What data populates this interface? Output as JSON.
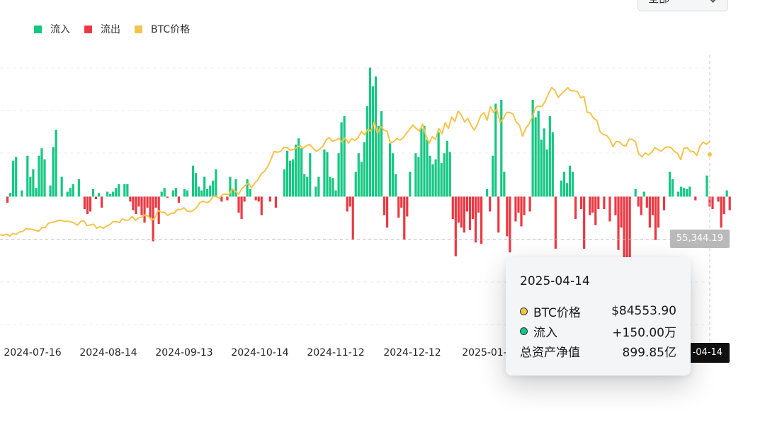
{
  "selector": {
    "value": "全部"
  },
  "legend": [
    {
      "label": "流入",
      "color": "#16c784"
    },
    {
      "label": "流出",
      "color": "#ea3943"
    },
    {
      "label": "BTC价格",
      "color": "#f3c44a"
    }
  ],
  "price_marker": {
    "value": "55,344.19"
  },
  "date_marker": {
    "value": "-04-14"
  },
  "tooltip": {
    "date": "2025-04-14",
    "rows": [
      {
        "label": "BTC价格",
        "value": "$84553.90",
        "dot_color": "#f3c44a"
      },
      {
        "label": "流入",
        "value": "+150.00万",
        "dot_color": "#16c784"
      },
      {
        "label": "总资产净值",
        "value": "899.85亿"
      }
    ]
  },
  "chart_data": {
    "type": "bar",
    "x_tick_labels": [
      "2024-07-16",
      "2024-08-14",
      "2024-09-13",
      "2024-10-14",
      "2024-11-12",
      "2024-12-12",
      "2025-01-"
    ],
    "grid": true,
    "flows": [
      -0.5,
      0.3,
      2.9,
      3.2,
      0.0,
      0.5,
      0.0,
      3.3,
      1.6,
      2.2,
      0.7,
      3.3,
      3.9,
      3.0,
      0.0,
      0.9,
      4.0,
      5.4,
      0.0,
      1.6,
      0.0,
      0.4,
      0.7,
      1.0,
      0.0,
      1.4,
      0.0,
      -1.0,
      -1.4,
      -1.2,
      0.6,
      -0.2,
      0.3,
      -0.9,
      0.0,
      0.4,
      0.2,
      0.4,
      0.7,
      1.0,
      0.0,
      1.0,
      1.0,
      -0.4,
      -1.1,
      -1.4,
      -0.8,
      -1.5,
      -2.1,
      -0.9,
      -1.7,
      -3.6,
      -0.9,
      -2.2,
      0.4,
      0.7,
      -0.1,
      0.0,
      0.5,
      0.7,
      -0.5,
      0.0,
      0.6,
      0.5,
      0.0,
      2.5,
      1.9,
      0.8,
      0.5,
      1.6,
      0.6,
      0.9,
      1.3,
      2.2,
      0.0,
      -0.4,
      0.0,
      -0.3,
      1.6,
      0.6,
      1.4,
      -1.3,
      -1.8,
      -0.4,
      1.4,
      0.6,
      0.0,
      -0.3,
      -0.4,
      -1.5,
      0.0,
      0.0,
      -0.4,
      0.0,
      -0.9,
      0.0,
      0.0,
      2.2,
      3.7,
      2.9,
      3.0,
      4.2,
      4.7,
      3.9,
      1.8,
      1.6,
      3.5,
      0.0,
      0.8,
      1.6,
      0.0,
      3.8,
      3.6,
      1.6,
      1.5,
      0.5,
      3.5,
      6.0,
      6.5,
      -1.2,
      -0.8,
      -3.5,
      2.0,
      3.5,
      2.8,
      4.4,
      7.3,
      10.4,
      8.9,
      9.7,
      5.7,
      6.9,
      -1.5,
      -2.5,
      4.3,
      3.5,
      1.8,
      -1.7,
      -0.9,
      -3.5,
      -1.6,
      2.0,
      0.0,
      3.5,
      3.2,
      5.5,
      5.7,
      4.6,
      3.3,
      2.6,
      3.0,
      5.2,
      2.7,
      3.5,
      4.5,
      3.6,
      -1.8,
      -4.8,
      -2.1,
      -2.5,
      -2.9,
      -1.2,
      -2.7,
      -1.8,
      -3.7,
      -1.3,
      -3.8,
      0.0,
      0.6,
      -1.2,
      3.3,
      7.5,
      -2.9,
      7.8,
      2.0,
      -3.2,
      -4.5,
      0.0,
      -2.0,
      -1.3,
      -2.4,
      -1.5,
      0.0,
      -1.2,
      7.8,
      6.4,
      6.9,
      4.6,
      5.5,
      3.8,
      6.5,
      5.2,
      -4.2,
      0.0,
      1.3,
      2.0,
      1.1,
      2.5,
      2.0,
      -1.8,
      0.0,
      -1.0,
      -4.2,
      0.0,
      -1.5,
      -1.3,
      -2.3,
      -1.0,
      0.0,
      -1.0,
      0.0,
      -2.0,
      0.0,
      -1.5,
      -4.3,
      -2.5,
      -5.6,
      -6.2,
      -9.8,
      0.0,
      0.6,
      -0.8,
      -1.5,
      0.4,
      -0.9,
      -2.5,
      -1.5,
      -3.5,
      -2.5,
      0.0,
      -1.1,
      0.0,
      2.0,
      1.4,
      0.0,
      0.4,
      0.8,
      0.7,
      0.6,
      0.8,
      0.0,
      -0.3,
      0.0,
      0.0,
      0.0,
      1.7,
      -0.8,
      -1.0,
      0.0,
      -0.4,
      -2.5,
      -1.4,
      0.5,
      -1.1
    ],
    "btc_price_series": [
      52000,
      51800,
      52200,
      51500,
      52500,
      52100,
      53000,
      53200,
      54200,
      54100,
      54000,
      53600,
      53300,
      54600,
      54600,
      56200,
      56500,
      56800,
      57200,
      57300,
      56900,
      57000,
      56700,
      56300,
      55500,
      56900,
      57100,
      55400,
      55600,
      55900,
      54400,
      55000,
      54400,
      55100,
      55700,
      56800,
      56800,
      56500,
      57800,
      57300,
      57400,
      58700,
      57300,
      58200,
      58500,
      59300,
      58800,
      57300,
      58200,
      60900,
      60300,
      60200,
      59100,
      59900,
      59900,
      61300,
      61200,
      61900,
      60700,
      60500,
      61000,
      62100,
      63900,
      64300,
      63800,
      64200,
      66100,
      66100,
      65400,
      66800,
      66900,
      66800,
      68800,
      67900,
      66900,
      69000,
      70000,
      71000,
      69300,
      71000,
      72300,
      74500,
      75300,
      77000,
      79700,
      82600,
      82300,
      82600,
      84100,
      84000,
      83000,
      83300,
      84000,
      84700,
      83700,
      84700,
      85200,
      83800,
      82600,
      83400,
      84300,
      86600,
      87700,
      86300,
      86700,
      87400,
      86000,
      87600,
      85600,
      87300,
      86600,
      87600,
      89900,
      88700,
      90700,
      90000,
      93400,
      89100,
      91700,
      90400,
      90000,
      85600,
      86200,
      87300,
      86700,
      87600,
      89300,
      90700,
      92300,
      91000,
      90000,
      92600,
      88500,
      85600,
      88000,
      87000,
      91000,
      89100,
      93100,
      91000,
      95200,
      93600,
      97400,
      96000,
      93400,
      94700,
      92200,
      90400,
      92600,
      95700,
      96800,
      94000,
      99100,
      96800,
      98200,
      93200,
      94600,
      96900,
      96900,
      96300,
      93400,
      92200,
      88200,
      91100,
      92700,
      95200,
      98600,
      99300,
      99000,
      101100,
      103800,
      106000,
      105000,
      102400,
      103700,
      104800,
      106000,
      104800,
      104800,
      104500,
      102300,
      102800,
      97000,
      96700,
      94700,
      94000,
      89800,
      88800,
      88500,
      87000,
      84400,
      86200,
      86100,
      84900,
      84500,
      87100,
      87000,
      86100,
      81600,
      80600,
      82000,
      81300,
      82300,
      84000,
      83200,
      82700,
      83900,
      84300,
      84000,
      82600,
      81900,
      79600,
      83700,
      84000,
      82600,
      82500,
      81100,
      84600,
      86000,
      85200,
      86300
    ]
  }
}
